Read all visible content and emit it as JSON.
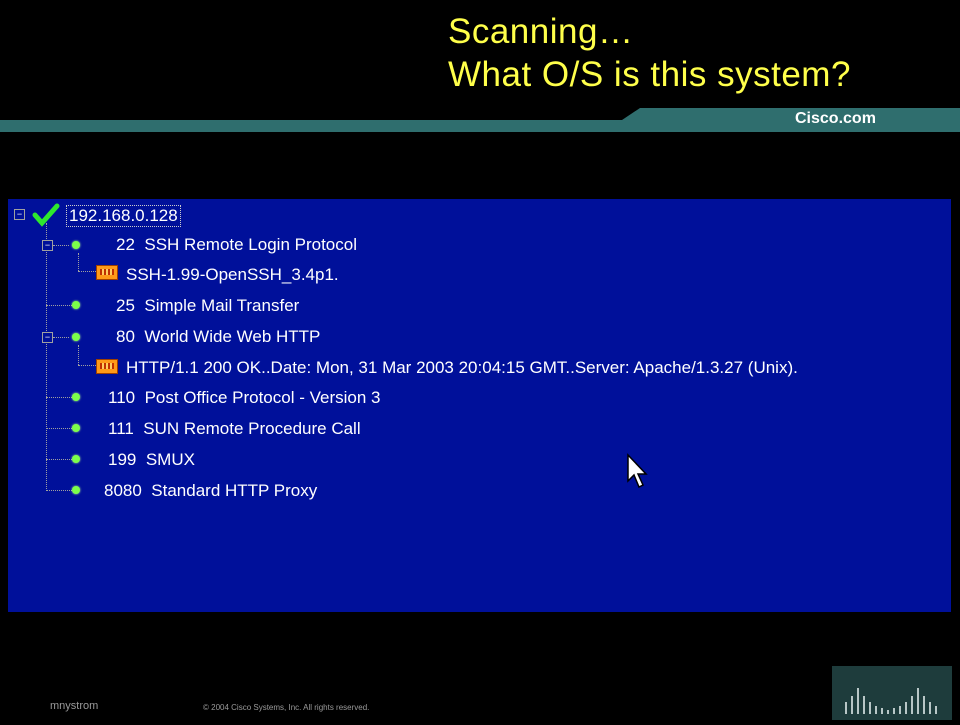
{
  "slide": {
    "title_line1": "Scanning…",
    "title_line2": "What O/S is this system?",
    "brand": "Cisco.com",
    "author": "mnystrom",
    "copyright": "© 2004  Cisco Systems, Inc. All rights reserved."
  },
  "tree": {
    "root": {
      "label": "192.168.0.128",
      "icon": "check-icon"
    },
    "items": [
      {
        "port": "22",
        "service": "SSH Remote Login Protocol",
        "expanded": true,
        "banner": "SSH-1.99-OpenSSH_3.4p1."
      },
      {
        "port": "25",
        "service": "Simple Mail Transfer"
      },
      {
        "port": "80",
        "service": "World Wide Web HTTP",
        "expanded": true,
        "banner": "HTTP/1.1 200 OK..Date: Mon, 31 Mar 2003 20:04:15 GMT..Server: Apache/1.3.27 (Unix)."
      },
      {
        "port": "110",
        "service": "Post Office Protocol - Version 3"
      },
      {
        "port": "111",
        "service": "SUN Remote Procedure Call"
      },
      {
        "port": "199",
        "service": "SMUX"
      },
      {
        "port": "8080",
        "service": "Standard HTTP Proxy"
      }
    ]
  },
  "colors": {
    "title": "#ffff4a",
    "panel_bg": "#00109a",
    "accent_bar": "#2f6e6e",
    "port_dot": "#7cff4a",
    "banner_icon": "#ff9a18"
  }
}
